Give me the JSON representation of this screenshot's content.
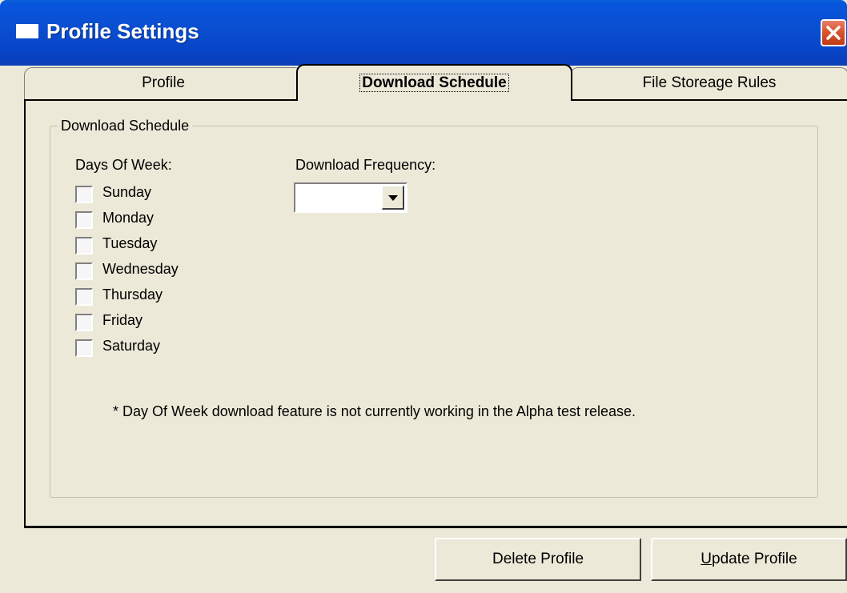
{
  "window": {
    "title": "Profile Settings"
  },
  "tabs": [
    {
      "label": "Profile",
      "active": false
    },
    {
      "label": "Download Schedule",
      "active": true
    },
    {
      "label": "File Storeage Rules",
      "active": false
    }
  ],
  "group": {
    "legend": "Download Schedule",
    "days_label": "Days Of Week:",
    "days": [
      {
        "label": "Sunday",
        "checked": false
      },
      {
        "label": "Monday",
        "checked": false
      },
      {
        "label": "Tuesday",
        "checked": false
      },
      {
        "label": "Wednesday",
        "checked": false
      },
      {
        "label": "Thursday",
        "checked": false
      },
      {
        "label": "Friday",
        "checked": false
      },
      {
        "label": "Saturday",
        "checked": false
      }
    ],
    "frequency_label": "Download Frequency:",
    "frequency_value": "",
    "note": "* Day Of Week download feature is not currently working in the Alpha test release."
  },
  "buttons": {
    "delete_label": "Delete Profile",
    "update_first": "U",
    "update_rest": "pdate Profile"
  },
  "colors": {
    "titlebar": "#0a4fd0",
    "face": "#ece9d8",
    "close": "#d9552f"
  }
}
